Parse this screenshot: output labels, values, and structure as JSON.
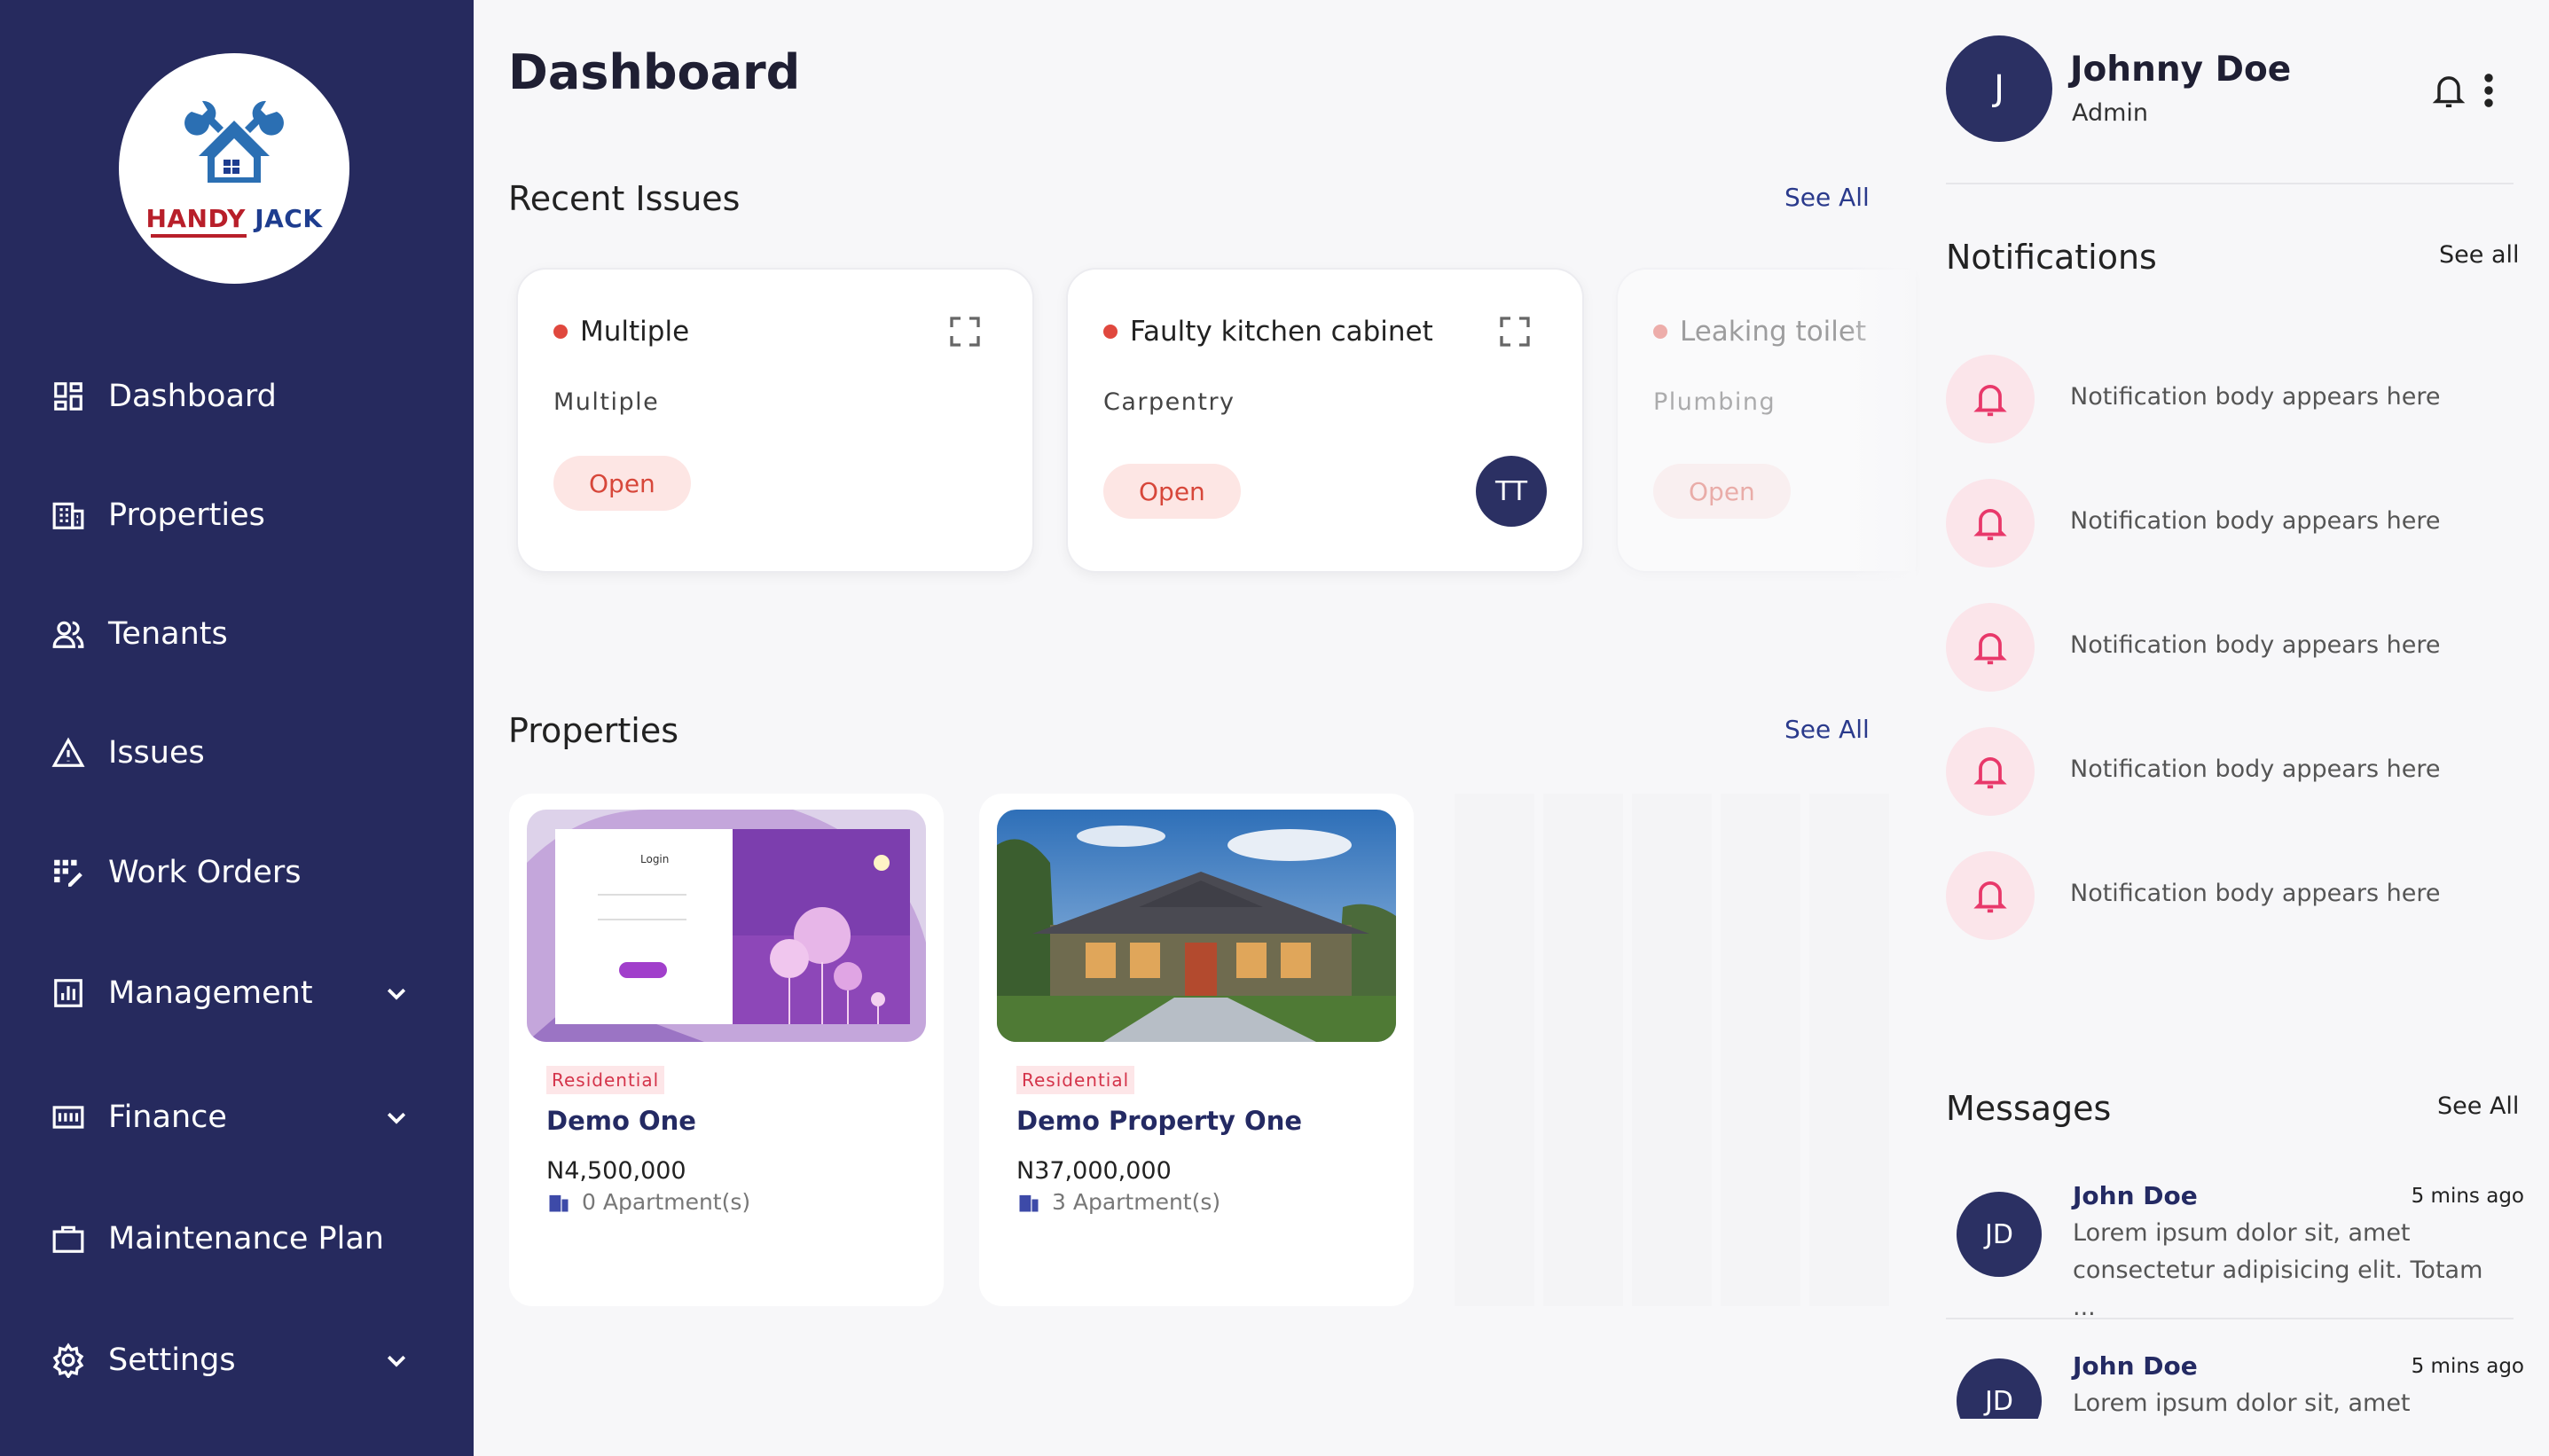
{
  "app": {
    "logo": {
      "word1": "HANDY",
      "word2": "JACK"
    }
  },
  "sidebar": {
    "items": [
      {
        "label": "Dashboard",
        "icon": "dashboard-icon"
      },
      {
        "label": "Properties",
        "icon": "building-icon"
      },
      {
        "label": "Tenants",
        "icon": "users-icon"
      },
      {
        "label": "Issues",
        "icon": "warning-icon"
      },
      {
        "label": "Work Orders",
        "icon": "work-orders-icon"
      },
      {
        "label": "Management",
        "icon": "chart-icon",
        "expandable": true
      },
      {
        "label": "Finance",
        "icon": "finance-icon",
        "expandable": true
      },
      {
        "label": "Maintenance Plan",
        "icon": "briefcase-icon"
      },
      {
        "label": "Settings",
        "icon": "gear-icon",
        "expandable": true
      }
    ]
  },
  "main": {
    "title": "Dashboard",
    "recent_issues": {
      "title": "Recent Issues",
      "see_all": "See All",
      "items": [
        {
          "title": "Multiple",
          "category": "Multiple",
          "status": "Open"
        },
        {
          "title": "Faulty kitchen cabinet",
          "category": "Carpentry",
          "status": "Open",
          "assignee": "TT"
        },
        {
          "title": "Leaking toilet",
          "category": "Plumbing",
          "status": "Open"
        }
      ]
    },
    "properties": {
      "title": "Properties",
      "see_all": "See All",
      "items": [
        {
          "tag": "Residential",
          "name": "Demo One",
          "price": "N4,500,000",
          "units": "0 Apartment(s)",
          "image": "login-screen-image"
        },
        {
          "tag": "Residential",
          "name": "Demo Property One",
          "price": "N37,000,000",
          "units": "3 Apartment(s)",
          "image": "house-photo"
        }
      ]
    }
  },
  "user": {
    "initial": "J",
    "name": "Johnny Doe",
    "role": "Admin"
  },
  "notifications": {
    "title": "Notifications",
    "see_all": "See all",
    "items": [
      {
        "body": "Notification body appears here"
      },
      {
        "body": "Notification body appears here"
      },
      {
        "body": "Notification body appears here"
      },
      {
        "body": "Notification body appears here"
      },
      {
        "body": "Notification body appears here"
      }
    ]
  },
  "messages": {
    "title": "Messages",
    "see_all": "See All",
    "items": [
      {
        "initials": "JD",
        "name": "John Doe",
        "time": "5 mins ago",
        "body": "Lorem ipsum dolor sit, amet consectetur adipisicing elit. Totam ..."
      },
      {
        "initials": "JD",
        "name": "John Doe",
        "time": "5 mins ago",
        "body": "Lorem ipsum dolor sit, amet"
      }
    ]
  },
  "colors": {
    "sidebar": "#262a5e",
    "accent_navy": "#2b3063",
    "status_red": "#d7473a",
    "notification_pink": "#e8386a"
  }
}
